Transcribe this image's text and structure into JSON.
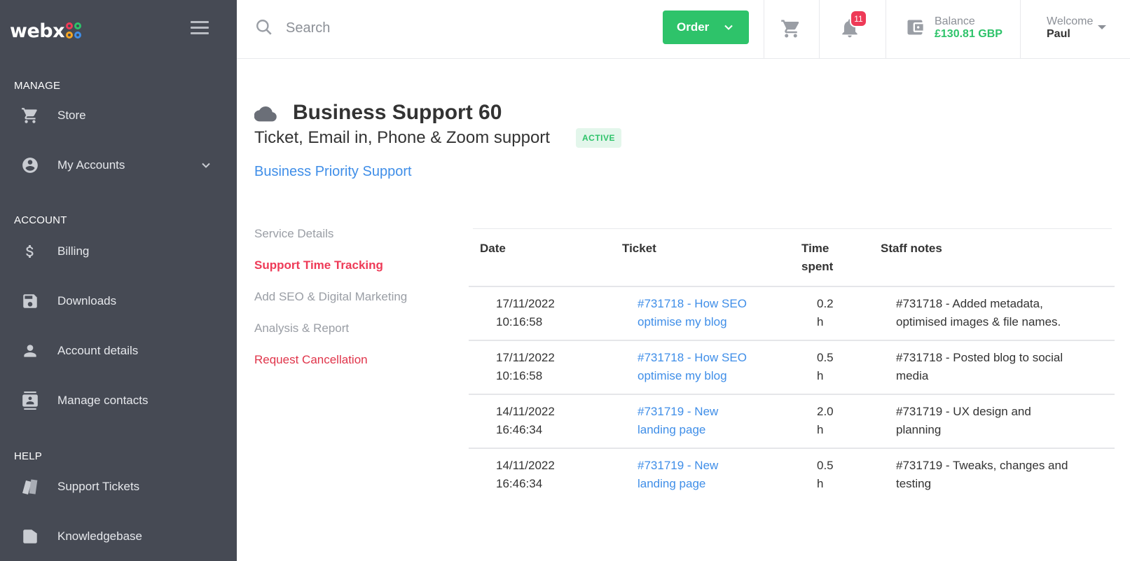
{
  "brand": {
    "logo_text": "webx",
    "logo_colors": [
      "#ee3a57",
      "#2ec36a",
      "#f5a623",
      "#3f8ee8"
    ]
  },
  "sidebar": {
    "sections": [
      {
        "label": "MANAGE"
      },
      {
        "label": "ACCOUNT"
      },
      {
        "label": "HELP"
      }
    ],
    "items": [
      {
        "label": "Store",
        "icon": "cart-icon"
      },
      {
        "label": "My Accounts",
        "icon": "account-circle-icon"
      },
      {
        "label": "Billing",
        "icon": "dollar-icon"
      },
      {
        "label": "Downloads",
        "icon": "save-icon"
      },
      {
        "label": "Account details",
        "icon": "person-icon"
      },
      {
        "label": "Manage contacts",
        "icon": "contacts-icon"
      },
      {
        "label": "Support Tickets",
        "icon": "tickets-icon"
      },
      {
        "label": "Knowledgebase",
        "icon": "book-icon"
      }
    ]
  },
  "topbar": {
    "search_placeholder": "Search",
    "order_label": "Order",
    "notifications_count": "11",
    "balance_label": "Balance",
    "balance_value": "£130.81 GBP",
    "welcome_label": "Welcome",
    "welcome_name": "Paul"
  },
  "service": {
    "title": "Business Support 60",
    "subtitle": "Ticket, Email in, Phone & Zoom support",
    "status": "ACTIVE",
    "group_link": "Business Priority Support"
  },
  "service_menu": [
    {
      "label": "Service Details",
      "state": "normal"
    },
    {
      "label": "Support Time Tracking",
      "state": "active"
    },
    {
      "label": "Add SEO & Digital Marketing",
      "state": "normal"
    },
    {
      "label": "Analysis & Report",
      "state": "normal"
    },
    {
      "label": "Request Cancellation",
      "state": "danger"
    }
  ],
  "table": {
    "headers": {
      "date": "Date",
      "ticket": "Ticket",
      "time_line1": "Time",
      "time_line2": "spent",
      "notes": "Staff notes"
    },
    "rows": [
      {
        "date": "17/11/2022",
        "time": "10:16:58",
        "ticket_line1": "#731718 - How SEO",
        "ticket_line2": "optimise my blog",
        "spent_value": "0.2",
        "spent_unit": "h",
        "notes_line1": "#731718 - Added metadata,",
        "notes_line2": "optimised images & file names."
      },
      {
        "date": "17/11/2022",
        "time": "10:16:58",
        "ticket_line1": "#731718 - How SEO",
        "ticket_line2": "optimise my blog",
        "spent_value": "0.5",
        "spent_unit": "h",
        "notes_line1": "#731718 - Posted blog to social",
        "notes_line2": "media"
      },
      {
        "date": "14/11/2022",
        "time": "16:46:34",
        "ticket_line1": "#731719 - New",
        "ticket_line2": "landing page",
        "spent_value": "2.0",
        "spent_unit": "h",
        "notes_line1": "#731719 - UX design and",
        "notes_line2": "planning"
      },
      {
        "date": "14/11/2022",
        "time": "16:46:34",
        "ticket_line1": "#731719 - New",
        "ticket_line2": "landing page",
        "spent_value": "0.5",
        "spent_unit": "h",
        "notes_line1": "#731719 - Tweaks, changes and",
        "notes_line2": "testing"
      }
    ]
  },
  "colors": {
    "sidebar_bg": "#464a54",
    "accent_green": "#2ec36a",
    "accent_red": "#ee3a57",
    "link_blue": "#3f8ee8"
  }
}
